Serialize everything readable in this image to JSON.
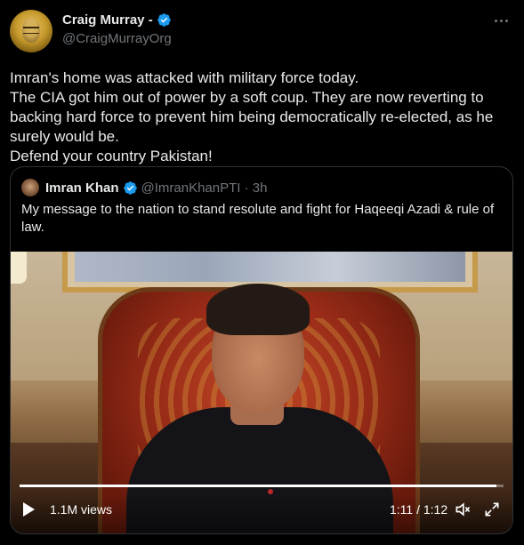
{
  "author": {
    "name": "Craig Murray -",
    "handle": "@CraigMurrayOrg"
  },
  "post": {
    "text": "Imran's home was attacked with military force today.\nThe CIA got him out of power by a soft coup. They are now reverting to backing hard force to prevent him being democratically re-elected, as he surely would be.\nDefend your country Pakistan!"
  },
  "quoted": {
    "name": "Imran Khan",
    "handle_time": "@ImranKhanPTI · 3h",
    "text": "My message to the nation to stand resolute and fight for Haqeeqi Azadi & rule of law.",
    "video": {
      "views": "1.1M views",
      "time": "1:11 / 1:12",
      "progress": 0.986
    }
  },
  "colors": {
    "verified": "#1d9bf0",
    "muted": "#71767b",
    "text": "#e7e9ea"
  }
}
